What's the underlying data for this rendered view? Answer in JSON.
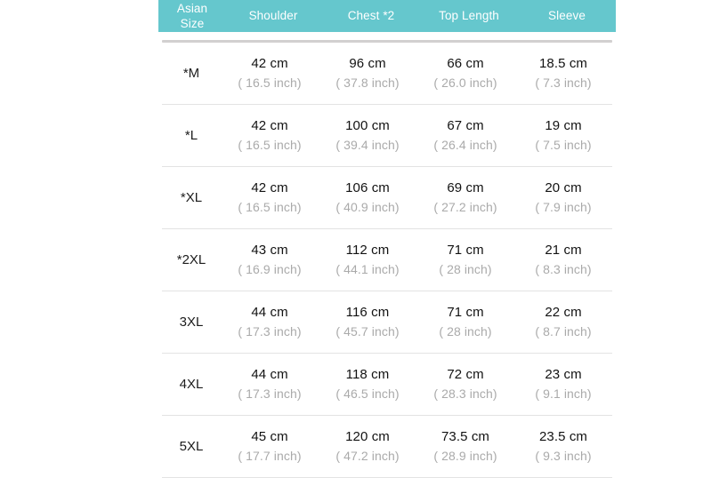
{
  "table": {
    "accent_color": "#65c7cd",
    "header_text_color": "#ffffff",
    "cm_text_color": "#121212",
    "inch_text_color": "#aaaaaa",
    "divider_color": "#e3e3e3",
    "header_rule_color": "#d2d0d0",
    "headers": {
      "size_line1": "Asian",
      "size_line2": "Size",
      "col1": "Shoulder",
      "col2": "Chest *2",
      "col3": "Top Length",
      "col4": "Sleeve"
    },
    "rows": [
      {
        "size": "*M",
        "shoulder_cm": "42 cm",
        "shoulder_inch": "( 16.5 inch)",
        "chest_cm": "96 cm",
        "chest_inch": "( 37.8 inch)",
        "length_cm": "66 cm",
        "length_inch": "( 26.0 inch)",
        "sleeve_cm": "18.5 cm",
        "sleeve_inch": "( 7.3 inch)"
      },
      {
        "size": "*L",
        "shoulder_cm": "42 cm",
        "shoulder_inch": "( 16.5 inch)",
        "chest_cm": "100 cm",
        "chest_inch": "( 39.4 inch)",
        "length_cm": "67 cm",
        "length_inch": "( 26.4 inch)",
        "sleeve_cm": "19 cm",
        "sleeve_inch": "( 7.5 inch)"
      },
      {
        "size": "*XL",
        "shoulder_cm": "42 cm",
        "shoulder_inch": "( 16.5 inch)",
        "chest_cm": "106 cm",
        "chest_inch": "( 40.9 inch)",
        "length_cm": "69 cm",
        "length_inch": "( 27.2 inch)",
        "sleeve_cm": "20 cm",
        "sleeve_inch": "( 7.9 inch)"
      },
      {
        "size": "*2XL",
        "shoulder_cm": "43 cm",
        "shoulder_inch": "( 16.9 inch)",
        "chest_cm": "112 cm",
        "chest_inch": "( 44.1 inch)",
        "length_cm": "71 cm",
        "length_inch": "( 28 inch)",
        "sleeve_cm": "21 cm",
        "sleeve_inch": "( 8.3 inch)"
      },
      {
        "size": "3XL",
        "shoulder_cm": "44 cm",
        "shoulder_inch": "( 17.3 inch)",
        "chest_cm": "116 cm",
        "chest_inch": "( 45.7 inch)",
        "length_cm": "71 cm",
        "length_inch": "( 28 inch)",
        "sleeve_cm": "22 cm",
        "sleeve_inch": "( 8.7 inch)"
      },
      {
        "size": "4XL",
        "shoulder_cm": "44 cm",
        "shoulder_inch": "( 17.3 inch)",
        "chest_cm": "118 cm",
        "chest_inch": "( 46.5 inch)",
        "length_cm": "72 cm",
        "length_inch": "( 28.3 inch)",
        "sleeve_cm": "23 cm",
        "sleeve_inch": "( 9.1 inch)"
      },
      {
        "size": "5XL",
        "shoulder_cm": "45 cm",
        "shoulder_inch": "( 17.7 inch)",
        "chest_cm": "120 cm",
        "chest_inch": "( 47.2 inch)",
        "length_cm": "73.5 cm",
        "length_inch": "( 28.9 inch)",
        "sleeve_cm": "23.5 cm",
        "sleeve_inch": "( 9.3 inch)"
      }
    ]
  }
}
